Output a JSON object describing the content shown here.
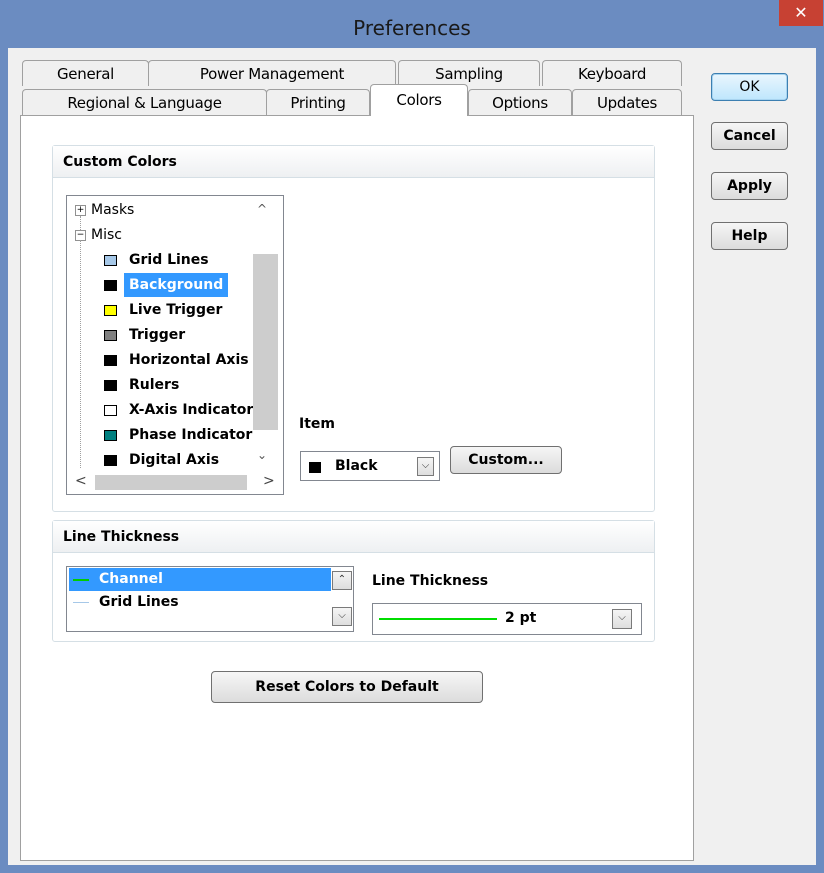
{
  "dialog": {
    "title": "Preferences",
    "close_glyph": "✕"
  },
  "tabs": {
    "row1": [
      {
        "label": "General"
      },
      {
        "label": "Power Management"
      },
      {
        "label": "Sampling"
      },
      {
        "label": "Keyboard"
      }
    ],
    "row2": [
      {
        "label": "Regional & Language"
      },
      {
        "label": "Printing"
      },
      {
        "label": "Colors",
        "active": true
      },
      {
        "label": "Options"
      },
      {
        "label": "Updates"
      }
    ]
  },
  "buttons": {
    "ok": "OK",
    "cancel": "Cancel",
    "apply": "Apply",
    "help": "Help"
  },
  "custom_colors": {
    "header": "Custom Colors",
    "tree": {
      "masks": {
        "label": "Masks",
        "expander": "+"
      },
      "misc": {
        "label": "Misc",
        "expander": "−"
      },
      "items": [
        {
          "label": "Grid Lines",
          "color": "#a6c8e8"
        },
        {
          "label": "Background",
          "color": "#000000",
          "selected": true
        },
        {
          "label": "Live Trigger",
          "color": "#ffff00"
        },
        {
          "label": "Trigger",
          "color": "#808080"
        },
        {
          "label": "Horizontal Axis",
          "color": "#000000"
        },
        {
          "label": "Rulers",
          "color": "#000000"
        },
        {
          "label": "X-Axis Indicator",
          "color": "#ffffff"
        },
        {
          "label": "Phase Indicator",
          "color": "#008080"
        },
        {
          "label": "Digital Axis",
          "color": "#000000"
        }
      ]
    },
    "item_label": "Item",
    "item_value": "Black",
    "item_color": "#000000",
    "custom_button": "Custom..."
  },
  "line_thickness": {
    "header": "Line Thickness",
    "items": [
      {
        "label": "Channel",
        "color": "#00cc00",
        "selected": true
      },
      {
        "label": "Grid Lines",
        "color": "#a6c8e8"
      }
    ],
    "field_label": "Line Thickness",
    "value": "2 pt",
    "line_color": "#00dd00"
  },
  "reset_button": "Reset Colors to Default",
  "colors": {
    "title_bar": "#6b8cc1",
    "selection": "#3399ff",
    "close": "#c74133"
  }
}
